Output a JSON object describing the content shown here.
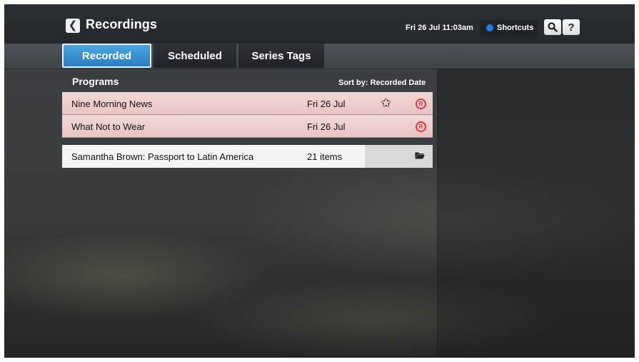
{
  "header": {
    "back_icon": "chevron-left-icon",
    "title": "Recordings",
    "datetime": "Fri 26 Jul 11:03am",
    "shortcuts_label": "Shortcuts",
    "shortcuts_dot_color": "#1f7ee8",
    "search_icon": "search-icon",
    "help_label": "?"
  },
  "tabs": [
    {
      "label": "Recorded",
      "active": true
    },
    {
      "label": "Scheduled",
      "active": false
    },
    {
      "label": "Series Tags",
      "active": false
    }
  ],
  "list": {
    "heading": "Programs",
    "sort_label": "Sort by: Recorded Date",
    "rows": [
      {
        "title": "Nine Morning News",
        "date": "Fri 26 Jul",
        "icons": [
          "star-icon",
          "record-icon"
        ],
        "state": "recorded"
      },
      {
        "title": "What Not to Wear",
        "date": "Fri 26 Jul",
        "icons": [
          "record-icon"
        ],
        "state": "recorded"
      },
      {
        "title": "Samantha Brown: Passport to Latin America",
        "date": "21 items",
        "icons": [
          "folder-icon"
        ],
        "state": "folder"
      }
    ],
    "record_symbol": "R"
  },
  "colors": {
    "accent": "#2a7dc2",
    "recorded_row": "#f3d8d8",
    "record_icon": "#e0353a"
  }
}
